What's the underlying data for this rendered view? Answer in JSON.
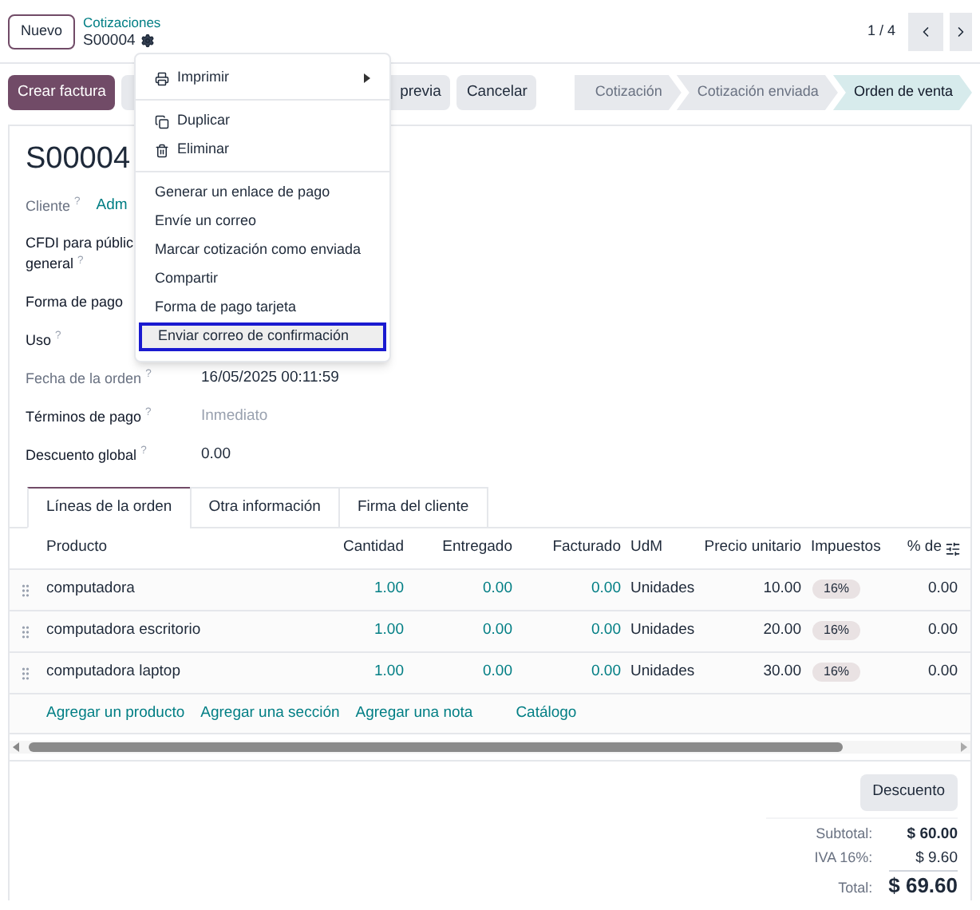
{
  "top_bar": {
    "new_button": "Nuevo",
    "breadcrumb": "Cotizaciones",
    "record": "S00004",
    "pager": "1 / 4"
  },
  "actions": [
    {
      "label": "Crear factura",
      "kind": "primary"
    },
    {
      "label": "previa",
      "kind": "secondary"
    },
    {
      "label": "Cancelar",
      "kind": "secondary"
    }
  ],
  "status_steps": [
    {
      "label": "Cotización",
      "selected": false
    },
    {
      "label": "Cotización enviada",
      "selected": false
    },
    {
      "label": "Orden de venta",
      "selected": true
    }
  ],
  "title": "S00004",
  "fields": [
    {
      "label_lines": [
        "Cliente $^{?}$"
      ],
      "label_muted": true,
      "value": "Adm",
      "kind": "link"
    },
    {
      "label_lines": [
        "CFDI para públic",
        "general $^{?}$"
      ],
      "label_muted": false,
      "kind": "empty"
    },
    {
      "label_lines": [
        "Forma de pago"
      ],
      "label_muted": false,
      "kind": "empty"
    },
    {
      "label_lines": [
        "Uso $^{?}$"
      ],
      "label_muted": false,
      "kind": "empty"
    },
    {
      "label_lines": [
        "Fecha de la orden $^{?}$"
      ],
      "label_muted": true,
      "value": "16/05/2025 00:11:59",
      "kind": "plain"
    },
    {
      "label_lines": [
        "Términos de pago $^{?}$"
      ],
      "label_muted": false,
      "placeholder": "Inmediato",
      "kind": "input"
    },
    {
      "label_lines": [
        "Descuento global $^{?}$"
      ],
      "label_muted": false,
      "value": "0.00",
      "kind": "plain"
    }
  ],
  "tabs": [
    {
      "label": "Líneas de la orden",
      "selected": true
    },
    {
      "label": "Otra información",
      "selected": false
    },
    {
      "label": "Firma del cliente",
      "selected": false
    }
  ],
  "table": {
    "columns": [
      "Producto",
      "Cantidad",
      "Entregado",
      "Facturado",
      "UdM",
      "Precio unitario",
      "Impuestos",
      "% de"
    ],
    "rows": [
      {
        "product": "computadora",
        "qty": "1.00",
        "delivered": "0.00",
        "invoiced": "0.00",
        "uom": "Unidades",
        "price": "10.00",
        "tax": "16%",
        "discount": "0.00"
      },
      {
        "product": "computadora escritorio",
        "qty": "1.00",
        "delivered": "0.00",
        "invoiced": "0.00",
        "uom": "Unidades",
        "price": "20.00",
        "tax": "16%",
        "discount": "0.00"
      },
      {
        "product": "computadora laptop",
        "qty": "1.00",
        "delivered": "0.00",
        "invoiced": "0.00",
        "uom": "Unidades",
        "price": "30.00",
        "tax": "16%",
        "discount": "0.00"
      }
    ],
    "add_links": [
      "Agregar un producto",
      "Agregar una sección",
      "Agregar una nota",
      "Catálogo"
    ]
  },
  "discount_button": "Descuento",
  "totals": [
    {
      "label": "Subtotal:",
      "value": "$ 60.00",
      "kind": "bold"
    },
    {
      "label": "IVA 16%:",
      "value": "$ 9.60",
      "kind": "plain"
    },
    {
      "label": "Total:",
      "value": "$ 69.60",
      "kind": "total"
    }
  ],
  "menu": {
    "groups": [
      [
        {
          "label": "Imprimir",
          "submenu": true,
          "highlighted": false
        }
      ],
      [
        {
          "label": "Duplicar",
          "submenu": false,
          "highlighted": false
        },
        {
          "label": "Eliminar",
          "submenu": false,
          "highlighted": false
        }
      ],
      [
        {
          "label": "Generar un enlace de pago",
          "submenu": false,
          "highlighted": false
        },
        {
          "label": "Envíe un correo",
          "submenu": false,
          "highlighted": false
        },
        {
          "label": "Marcar cotización como enviada",
          "submenu": false,
          "highlighted": false
        },
        {
          "label": "Compartir",
          "submenu": false,
          "highlighted": false
        },
        {
          "label": "Forma de pago tarjeta",
          "submenu": false,
          "highlighted": false
        },
        {
          "label": "Enviar correo de confirmación",
          "submenu": false,
          "highlighted": true
        }
      ]
    ]
  }
}
